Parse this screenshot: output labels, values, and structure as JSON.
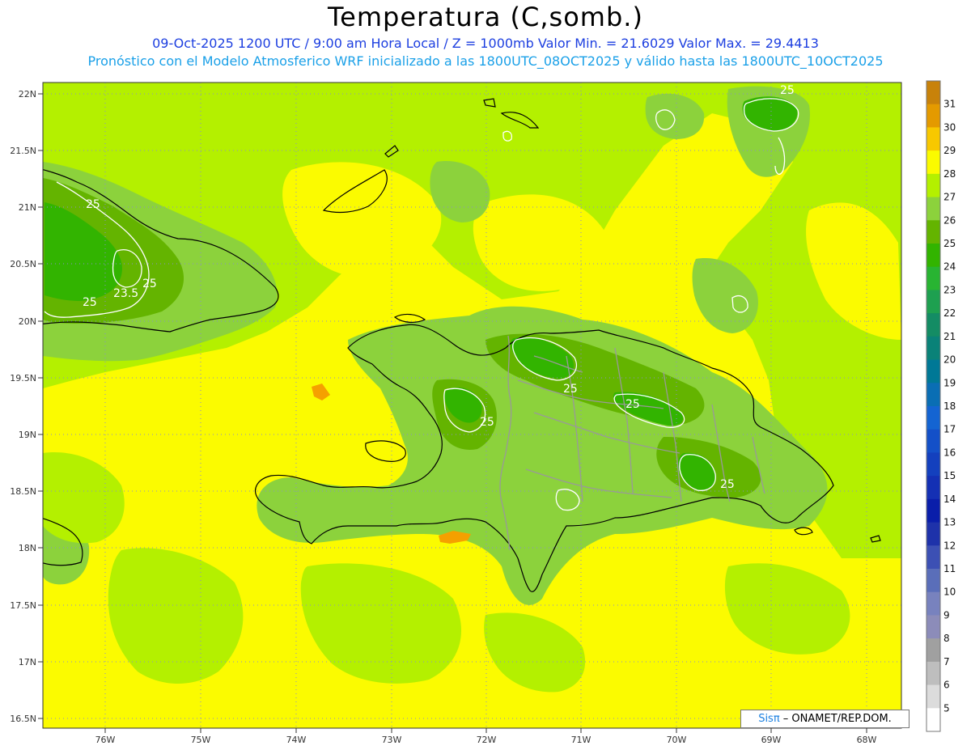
{
  "header": {
    "title": "Temperatura (C,somb.)",
    "line1": "09-Oct-2025  1200 UTC / 9:00 am Hora Local / Z = 1000mb   Valor Min. = 21.6029  Valor Max. = 29.4413",
    "line2": "Pronóstico con el Modelo Atmosferico WRF inicializado a las 1800UTC_08OCT2025 y válido hasta las  1800UTC_10OCT2025"
  },
  "axes": {
    "lat_labels": [
      "22N",
      "21.5N",
      "21N",
      "20.5N",
      "20N",
      "19.5N",
      "19N",
      "18.5N",
      "18N",
      "17.5N",
      "17N",
      "16.5N"
    ],
    "lon_labels": [
      "76W",
      "75W",
      "74W",
      "73W",
      "72W",
      "71W",
      "70W",
      "69W",
      "68W"
    ]
  },
  "contour_labels": [
    "25",
    "25",
    "25",
    "23.5",
    "25",
    "25",
    "25",
    "25",
    "25",
    "25"
  ],
  "colorbar": {
    "labels": [
      "31",
      "30",
      "29",
      "28",
      "27",
      "26",
      "25",
      "24",
      "23",
      "22",
      "21",
      "20",
      "19",
      "18",
      "17",
      "16",
      "15",
      "14",
      "13",
      "12",
      "11",
      "10",
      "9",
      "8",
      "7",
      "6",
      "5"
    ],
    "colors": [
      "#c8820a",
      "#e49a00",
      "#f8c800",
      "#fbfb00",
      "#b4f000",
      "#8cd23c",
      "#64b400",
      "#32b400",
      "#28b432",
      "#1ea050",
      "#148c64",
      "#0a8278",
      "#007896",
      "#0a6eb4",
      "#1464d2",
      "#1450c8",
      "#1440be",
      "#1430b4",
      "#0a1eaa",
      "#1e32aa",
      "#3c50b4",
      "#5a6eb9",
      "#7882be",
      "#8c8cb9",
      "#a0a0a0",
      "#bebebe",
      "#dcdcdc",
      "#ffffff"
    ]
  },
  "credit": {
    "sis": "Sisπ",
    "text": " – ONAMET/REP.DOM."
  },
  "colors": {
    "sea": "#fbfb00",
    "land_27": "#b4f000",
    "land_26": "#8cd23c",
    "land_25": "#64b400",
    "land_24": "#32b400",
    "warm_30": "#f5a000",
    "border": "#999999",
    "coast": "#000000",
    "grid": "#8a8ad0"
  }
}
